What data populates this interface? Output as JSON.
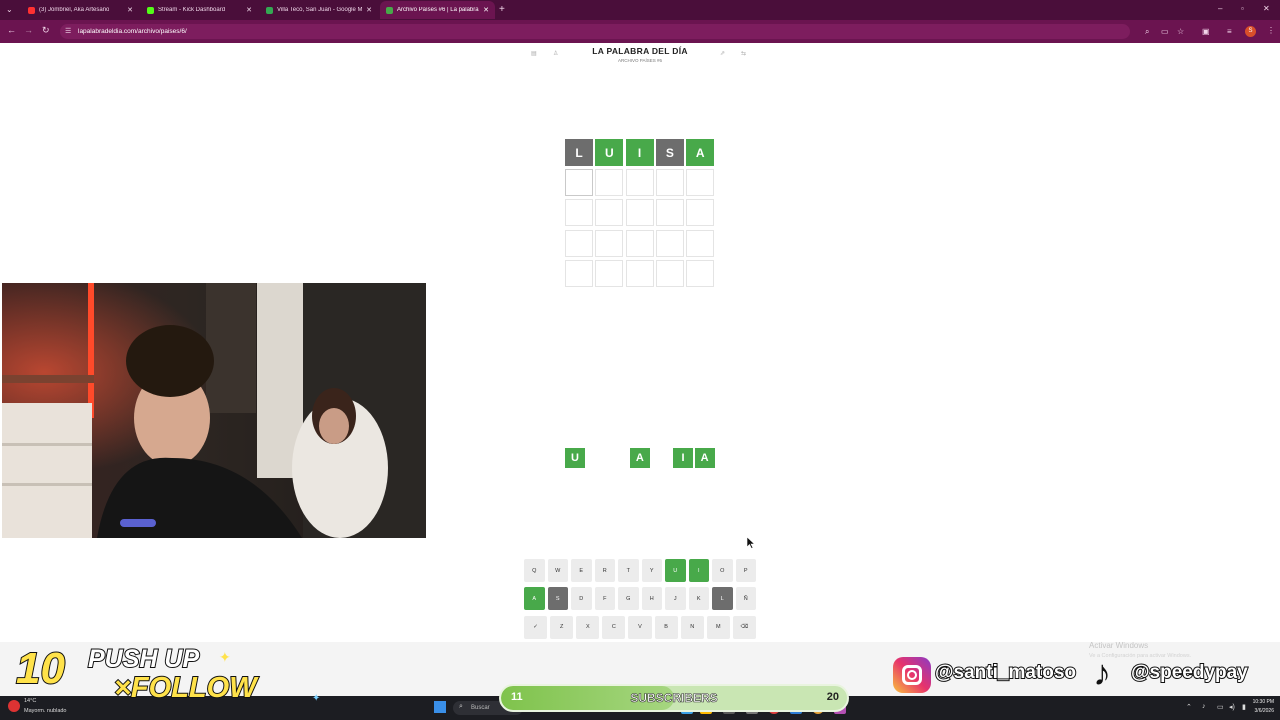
{
  "browser": {
    "tabs": [
      {
        "title": "(3) Jombriel, Aka Artesano",
        "fav_color": "#ff3131"
      },
      {
        "title": "Stream - Kick Dashboard",
        "fav_color": "#53fc18"
      },
      {
        "title": "Villa Tecó, San Juan - Google M",
        "fav_color": "#34a853"
      },
      {
        "title": "Archivo Países #6 | La palabra d",
        "fav_color": "#48a94a"
      }
    ],
    "url": "lapalabradeldia.com/archivo/paises/6/",
    "profile_initial": "S"
  },
  "game": {
    "title": "LA PALABRA DEL DÍA",
    "subtitle": "ARCHIVO PAÍSES #6",
    "board": [
      [
        {
          "l": "L",
          "s": "absent"
        },
        {
          "l": "U",
          "s": "correct"
        },
        {
          "l": "I",
          "s": "correct"
        },
        {
          "l": "S",
          "s": "absent"
        },
        {
          "l": "A",
          "s": "correct"
        }
      ],
      [
        {
          "l": "",
          "s": "current"
        },
        {
          "l": "",
          "s": "empty"
        },
        {
          "l": "",
          "s": "empty"
        },
        {
          "l": "",
          "s": "empty"
        },
        {
          "l": "",
          "s": "empty"
        }
      ],
      [
        {
          "l": "",
          "s": "empty"
        },
        {
          "l": "",
          "s": "empty"
        },
        {
          "l": "",
          "s": "empty"
        },
        {
          "l": "",
          "s": "empty"
        },
        {
          "l": "",
          "s": "empty"
        }
      ],
      [
        {
          "l": "",
          "s": "empty"
        },
        {
          "l": "",
          "s": "empty"
        },
        {
          "l": "",
          "s": "empty"
        },
        {
          "l": "",
          "s": "empty"
        },
        {
          "l": "",
          "s": "empty"
        }
      ],
      [
        {
          "l": "",
          "s": "empty"
        },
        {
          "l": "",
          "s": "empty"
        },
        {
          "l": "",
          "s": "empty"
        },
        {
          "l": "",
          "s": "empty"
        },
        {
          "l": "",
          "s": "empty"
        }
      ]
    ],
    "hint": [
      {
        "l": "U",
        "s": "correct"
      },
      {
        "l": "",
        "s": "empty"
      },
      {
        "l": "",
        "s": "empty"
      },
      {
        "l": "A",
        "s": "correct"
      },
      {
        "l": "",
        "s": "empty"
      },
      {
        "l": "I",
        "s": "correct"
      },
      {
        "l": "A",
        "s": "correct"
      }
    ],
    "keyboard": [
      [
        {
          "k": "Q"
        },
        {
          "k": "W"
        },
        {
          "k": "E"
        },
        {
          "k": "R"
        },
        {
          "k": "T"
        },
        {
          "k": "Y"
        },
        {
          "k": "U",
          "s": "correct"
        },
        {
          "k": "I",
          "s": "correct"
        },
        {
          "k": "O"
        },
        {
          "k": "P"
        }
      ],
      [
        {
          "k": "A",
          "s": "correct"
        },
        {
          "k": "S",
          "s": "absent"
        },
        {
          "k": "D"
        },
        {
          "k": "F"
        },
        {
          "k": "G"
        },
        {
          "k": "H"
        },
        {
          "k": "J"
        },
        {
          "k": "K"
        },
        {
          "k": "L",
          "s": "absent"
        },
        {
          "k": "Ñ"
        }
      ],
      [
        {
          "k": "✓"
        },
        {
          "k": "Z"
        },
        {
          "k": "X"
        },
        {
          "k": "C"
        },
        {
          "k": "V"
        },
        {
          "k": "B"
        },
        {
          "k": "N"
        },
        {
          "k": "M"
        },
        {
          "k": "⌫"
        }
      ]
    ]
  },
  "overlay": {
    "push_number": "10",
    "push_text": "PUSH UP",
    "follow_text": "×FOLLOW",
    "sub_current": "11",
    "sub_label": "SUBSCRIBERS",
    "sub_goal": "20",
    "sub_progress": 0.5,
    "instagram": "@santi_matoso",
    "tiktok": "@speedypay"
  },
  "windows": {
    "activate_title": "Activar Windows",
    "activate_sub": "Ve a Configuración para activar Windows.",
    "weather_temp": "14°C",
    "weather_desc": "Mayorm. nublado",
    "search_placeholder": "Buscar",
    "time": "10:30 PM",
    "date": "3/6/2026"
  }
}
